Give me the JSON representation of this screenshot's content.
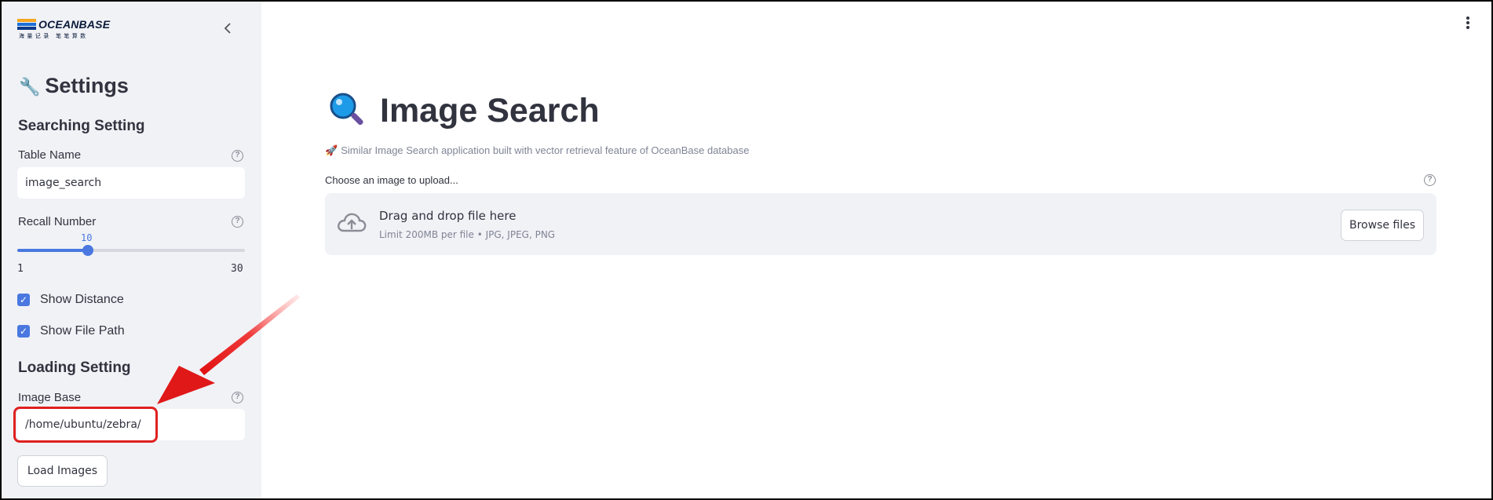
{
  "sidebar": {
    "logo": {
      "brand": "OCEANBASE",
      "tagline": "海量记录 笔笔算数"
    },
    "settings_title": "Settings",
    "searching_heading": "Searching Setting",
    "table_name": {
      "label": "Table Name",
      "value": "image_search"
    },
    "recall_number": {
      "label": "Recall Number",
      "value": "10",
      "min": "1",
      "max": "30",
      "fraction": 0.31
    },
    "show_distance": {
      "label": "Show Distance",
      "checked": true
    },
    "show_file_path": {
      "label": "Show File Path",
      "checked": true
    },
    "loading_heading": "Loading Setting",
    "image_base": {
      "label": "Image Base",
      "value": "/home/ubuntu/zebra/"
    },
    "load_button": "Load Images"
  },
  "main": {
    "title": "Image Search",
    "subtitle": "Similar Image Search application built with vector retrieval feature of OceanBase database",
    "upload_label": "Choose an image to upload...",
    "dropzone": {
      "title": "Drag and drop file here",
      "limit": "Limit 200MB per file • JPG, JPEG, PNG",
      "browse_button": "Browse files"
    }
  },
  "icons": {
    "collapse": "chevron-left-icon",
    "settings": "wrench-icon",
    "help": "question-circle-icon",
    "title": "magnifying-glass-icon",
    "subtitle": "rocket-icon",
    "upload": "cloud-upload-icon",
    "menu": "vertical-dots-icon"
  },
  "colors": {
    "accent": "#4a78e0",
    "annotation": "#e02020",
    "sidebar_bg": "#f0f2f6"
  }
}
